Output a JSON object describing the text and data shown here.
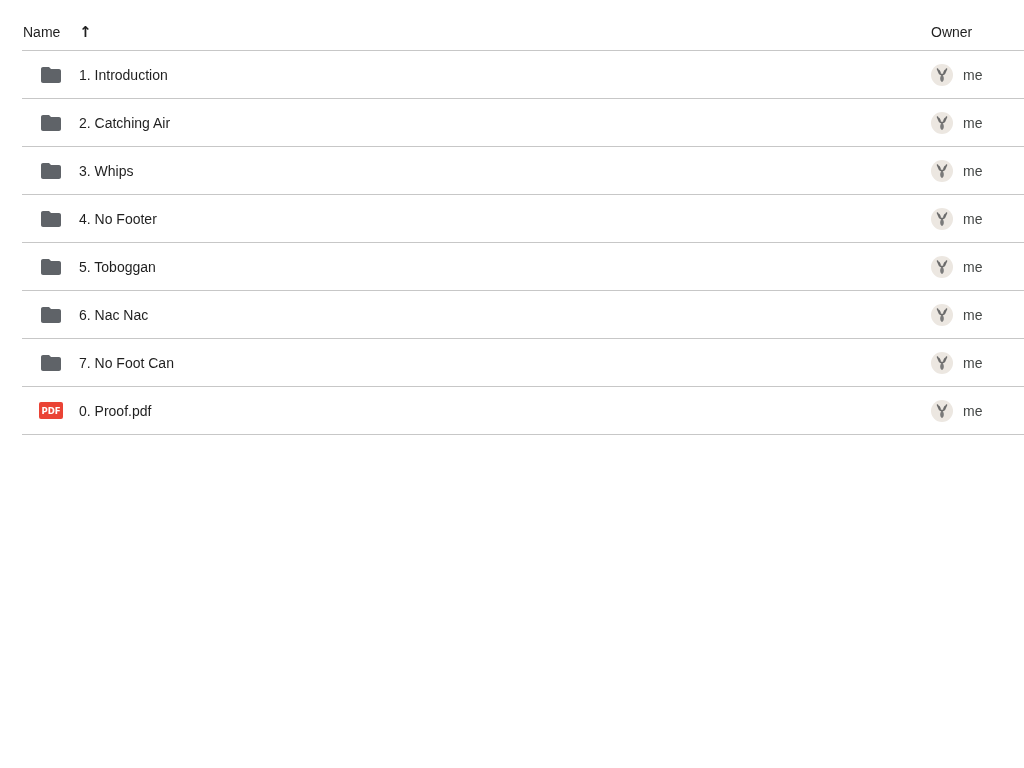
{
  "table": {
    "columns": [
      {
        "label": "Name",
        "sort_indicator": "↑"
      },
      {
        "label": "Owner"
      }
    ],
    "rows": [
      {
        "kind": "folder",
        "name": "1. Introduction",
        "owner": "me"
      },
      {
        "kind": "folder",
        "name": "2. Catching Air",
        "owner": "me"
      },
      {
        "kind": "folder",
        "name": "3. Whips",
        "owner": "me"
      },
      {
        "kind": "folder",
        "name": "4. No Footer",
        "owner": "me"
      },
      {
        "kind": "folder",
        "name": "5. Toboggan",
        "owner": "me"
      },
      {
        "kind": "folder",
        "name": "6. Nac Nac",
        "owner": "me"
      },
      {
        "kind": "folder",
        "name": "7. No Foot Can",
        "owner": "me"
      },
      {
        "kind": "pdf",
        "name": "0. Proof.pdf",
        "owner": "me",
        "badge": "PDF"
      }
    ]
  }
}
